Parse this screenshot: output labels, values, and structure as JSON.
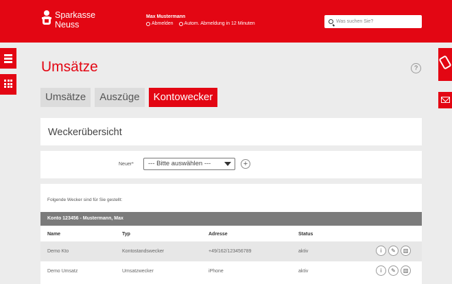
{
  "header": {
    "brand_line1": "Sparkasse",
    "brand_line2": "Neuss",
    "user_name": "Max Mustermann",
    "logout_label": "Abmelden",
    "auto_logout_label": "Autom. Abmeldung in 12 Minuten",
    "search_placeholder": "Was suchen Sie?"
  },
  "page": {
    "title": "Umsätze",
    "help_label": "?"
  },
  "tabs": [
    {
      "label": "Umsätze",
      "active": false
    },
    {
      "label": "Auszüge",
      "active": false
    },
    {
      "label": "Kontowecker",
      "active": true
    }
  ],
  "overview": {
    "title": "Weckerübersicht"
  },
  "new_alarm": {
    "label": "Neuer*",
    "select_value": "--- Bitte auswählen ---",
    "add_label": "+"
  },
  "alarms": {
    "intro": "Folgende Wecker sind für Sie gestellt:",
    "account_bar": "Konto 123456 - Mustermann, Max",
    "columns": [
      "Name",
      "Typ",
      "Adresse",
      "Status"
    ],
    "rows": [
      {
        "name": "Demo Kto",
        "type": "Kontostandswecker",
        "address": "+49/162/123456789",
        "status": "aktiv"
      },
      {
        "name": "Demo Umsatz",
        "type": "Umsatzwecker",
        "address": "iPhone",
        "status": "aktiv"
      }
    ]
  },
  "colors": {
    "brand_red": "#e30613",
    "background": "#ececec",
    "account_bar": "#7b7b7b"
  },
  "icons": [
    "menu-icon",
    "apps-grid-icon",
    "phone-icon",
    "mail-icon",
    "search-icon",
    "help-icon",
    "info-icon",
    "edit-icon",
    "delete-icon",
    "add-icon",
    "logout-icon",
    "timer-icon"
  ]
}
